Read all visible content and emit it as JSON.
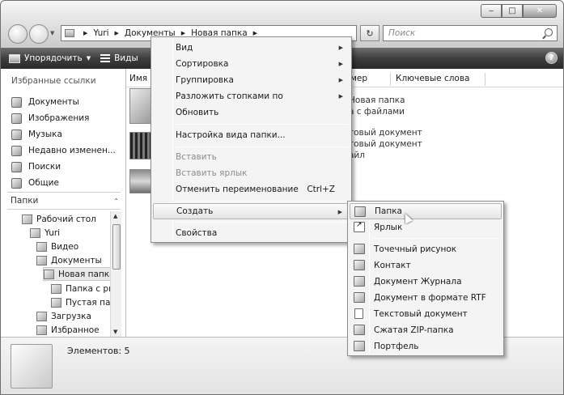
{
  "window": {
    "caption": {
      "minimize": "‒",
      "maximize": "□",
      "close": "✕"
    }
  },
  "nav": {
    "address": [
      "Yuri",
      "Документы",
      "Новая папка"
    ],
    "search_placeholder": "Поиск"
  },
  "toolbar": {
    "organize_label": "Упорядочить",
    "views_label": "Виды",
    "help": "?"
  },
  "left_panel": {
    "favorites_header": "Избранные ссылки",
    "favorites": [
      "Документы",
      "Изображения",
      "Музыка",
      "Недавно изменен...",
      "Поиски",
      "Общие"
    ],
    "folders_header": "Папки",
    "tree": [
      "Рабочий стол",
      "Yuri",
      "Видео",
      "Документы",
      "Новая папка",
      "Папка с ри",
      "Пустая пап",
      "Загрузка",
      "Избранное"
    ]
  },
  "file_area": {
    "columns": [
      "Имя",
      "мер",
      "Ключевые слова"
    ],
    "row_texts": [
      "Новая папка",
      "а с файлами",
      "товый документ",
      "товый документ",
      "айл"
    ]
  },
  "status": {
    "items_label": "Элементов: 5"
  },
  "context_menu": {
    "view": "Вид",
    "sort": "Сортировка",
    "group": "Группировка",
    "stack": "Разложить стопками по",
    "refresh": "Обновить",
    "customize": "Настройка вида папки...",
    "paste": "Вставить",
    "paste_shortcut": "Вставить ярлык",
    "undo_rename": "Отменить переименование",
    "undo_shortcut_key": "Ctrl+Z",
    "create": "Создать",
    "properties": "Свойства"
  },
  "submenu": {
    "folder": "Папка",
    "shortcut": "Ярлык",
    "bitmap": "Точечный рисунок",
    "contact": "Контакт",
    "journal": "Документ Журнала",
    "rtf": "Документ в формате RTF",
    "text": "Текстовый документ",
    "zip": "Сжатая ZIP-папка",
    "briefcase": "Портфель"
  }
}
